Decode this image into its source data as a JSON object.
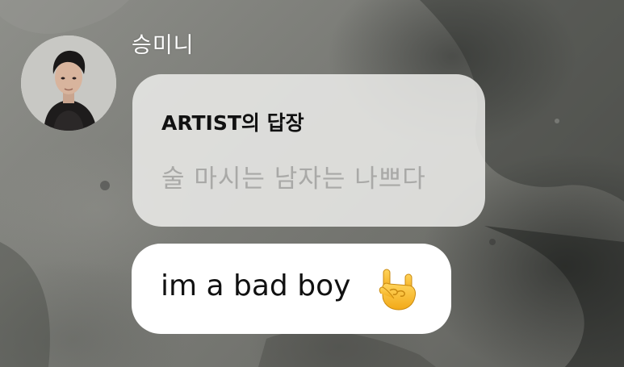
{
  "sender": {
    "name": "승미니"
  },
  "reply": {
    "title": "ARTIST의 답장",
    "quoted_text": "술 마시는 남자는 나쁘다"
  },
  "message": {
    "text": "im a bad boy",
    "emoji_icon": "sign-of-the-horns-icon"
  },
  "colors": {
    "reply_bubble": "#ecece8",
    "message_bubble": "#ffffff",
    "quoted_text": "#a9a9a7"
  }
}
